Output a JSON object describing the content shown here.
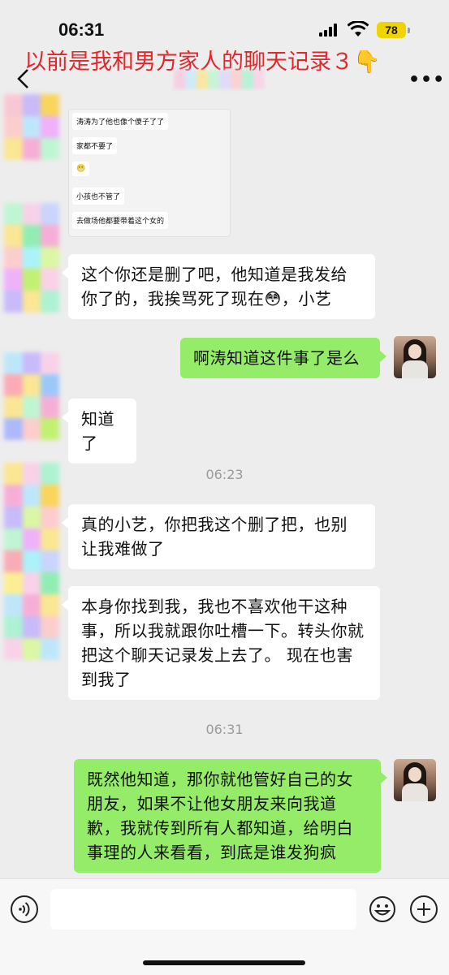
{
  "status": {
    "time": "06:31",
    "battery": "78"
  },
  "headline": "以前是我和男方家人的聊天记录３👇",
  "nav": {
    "back_icon": "chevron-left-icon",
    "more_icon": "ellipsis-icon"
  },
  "screenshot_messages": [
    "涛涛为了他也像个傻子了了",
    "家都不要了",
    "😬",
    "小孩也不管了",
    "去做场他都要带着这个女的"
  ],
  "messages": [
    {
      "side": "left",
      "text": "这个你还是删了吧，他知道是我发给你了的，我挨骂死了现在😳，小艺"
    },
    {
      "side": "right",
      "text": "啊涛知道这件事了是么"
    },
    {
      "side": "left",
      "text": "知道了"
    },
    {
      "side": "left",
      "text": "真的小艺，你把我这个删了把，也别让我难做了"
    },
    {
      "side": "left",
      "text": "本身你找到我，我也不喜欢他干这种事，所以我就跟你吐槽一下。转头你就把这个聊天记录发上去了。 现在也害到我了"
    },
    {
      "side": "right",
      "text": "既然他知道，那你就他管好自己的女朋友，如果不让他女朋友来向我道歉，我就传到所有人都知道，给明白事理的人来看看，到底是谁发狗疯"
    }
  ],
  "timestamps": [
    "06:23",
    "06:31"
  ],
  "input": {
    "placeholder": ""
  },
  "colors": {
    "own_bubble": "#95ec69",
    "headline": "#e2262b",
    "background": "#ededed"
  }
}
